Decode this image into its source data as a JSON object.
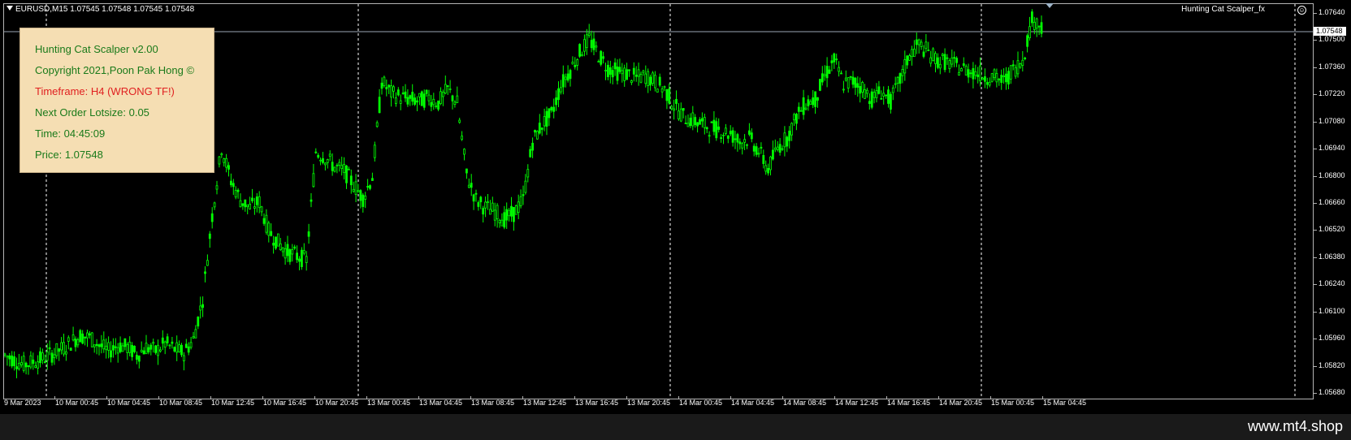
{
  "chart": {
    "symbol_title": "EURUSD,M15  1.07545 1.07548 1.07545 1.07548",
    "expert_name": "Hunting Cat Scalper_fx",
    "current_price_label": "1.07548",
    "price_axis": [
      "1.07640",
      "1.07500",
      "1.07360",
      "1.07220",
      "1.07080",
      "1.06940",
      "1.06800",
      "1.06660",
      "1.06520",
      "1.06380",
      "1.06240",
      "1.06100",
      "1.05960",
      "1.05820",
      "1.05680"
    ],
    "time_axis": [
      "9 Mar 2023",
      "10 Mar 00:45",
      "10 Mar 04:45",
      "10 Mar 08:45",
      "10 Mar 12:45",
      "10 Mar 16:45",
      "10 Mar 20:45",
      "13 Mar 00:45",
      "13 Mar 04:45",
      "13 Mar 08:45",
      "13 Mar 12:45",
      "13 Mar 16:45",
      "13 Mar 20:45",
      "14 Mar 00:45",
      "14 Mar 04:45",
      "14 Mar 08:45",
      "14 Mar 12:45",
      "14 Mar 16:45",
      "14 Mar 20:45",
      "15 Mar 00:45",
      "15 Mar 04:45"
    ],
    "candle_color": "#00ff00",
    "background": "#000000"
  },
  "info_panel": {
    "title": "Hunting Cat Scalper v2.00",
    "copyright": "Copyright 2021,Poon Pak Hong ©",
    "timeframe": "Timeframe: H4 (WRONG TF!)",
    "lotsize": "Next Order Lotsize: 0.05",
    "time": "Time: 04:45:09",
    "price": "Price: 1.07548",
    "text_color": "#1a7a1a",
    "warning_color": "#e02020",
    "background": "#f5deb3"
  },
  "footer": {
    "brand": "www.mt4.shop"
  },
  "chart_data": {
    "type": "line",
    "ylim": [
      1.0568,
      1.0766
    ],
    "anchors": [
      [
        0,
        1.0588
      ],
      [
        2,
        1.0583
      ],
      [
        4,
        1.0586
      ],
      [
        6,
        1.0591
      ],
      [
        8,
        1.0598
      ],
      [
        9,
        1.0597
      ],
      [
        10,
        1.0593
      ],
      [
        11,
        1.059
      ],
      [
        12,
        1.0593
      ],
      [
        13,
        1.0592
      ],
      [
        14,
        1.0588
      ],
      [
        15,
        1.0592
      ],
      [
        16,
        1.059
      ],
      [
        17,
        1.0594
      ],
      [
        18,
        1.0591
      ],
      [
        19,
        1.0589
      ],
      [
        20,
        1.0596
      ],
      [
        21,
        1.0617
      ],
      [
        22,
        1.066
      ],
      [
        23,
        1.0695
      ],
      [
        24,
        1.0678
      ],
      [
        25,
        1.0668
      ],
      [
        26,
        1.0664
      ],
      [
        27,
        1.0667
      ],
      [
        28,
        1.0652
      ],
      [
        29,
        1.0646
      ],
      [
        30,
        1.0641
      ],
      [
        31,
        1.0639
      ],
      [
        32,
        1.0637
      ],
      [
        33,
        1.0693
      ],
      [
        34,
        1.069
      ],
      [
        35,
        1.0685
      ],
      [
        36,
        1.0683
      ],
      [
        37,
        1.0676
      ],
      [
        38,
        1.0669
      ],
      [
        39,
        1.068
      ],
      [
        40,
        1.0729
      ],
      [
        41,
        1.0723
      ],
      [
        42,
        1.0721
      ],
      [
        43,
        1.072
      ],
      [
        44,
        1.0719
      ],
      [
        45,
        1.0721
      ],
      [
        46,
        1.0718
      ],
      [
        47,
        1.0725
      ],
      [
        48,
        1.0718
      ],
      [
        49,
        1.0681
      ],
      [
        50,
        1.0668
      ],
      [
        51,
        1.0664
      ],
      [
        52,
        1.0662
      ],
      [
        53,
        1.0658
      ],
      [
        54,
        1.0661
      ],
      [
        55,
        1.0668
      ],
      [
        56,
        1.0698
      ],
      [
        57,
        1.0707
      ],
      [
        58,
        1.0712
      ],
      [
        59,
        1.0727
      ],
      [
        60,
        1.0735
      ],
      [
        61,
        1.0744
      ],
      [
        62,
        1.0751
      ],
      [
        63,
        1.0743
      ],
      [
        64,
        1.0736
      ],
      [
        65,
        1.0734
      ],
      [
        66,
        1.0733
      ],
      [
        67,
        1.0731
      ],
      [
        68,
        1.0732
      ],
      [
        69,
        1.0729
      ],
      [
        70,
        1.0725
      ],
      [
        71,
        1.0717
      ],
      [
        72,
        1.0711
      ],
      [
        73,
        1.0709
      ],
      [
        74,
        1.0707
      ],
      [
        75,
        1.0705
      ],
      [
        76,
        1.0704
      ],
      [
        77,
        1.0702
      ],
      [
        78,
        1.0698
      ],
      [
        79,
        1.07
      ],
      [
        80,
        1.0693
      ],
      [
        81,
        1.0684
      ],
      [
        82,
        1.0695
      ],
      [
        83,
        1.07
      ],
      [
        84,
        1.0711
      ],
      [
        85,
        1.0718
      ],
      [
        86,
        1.072
      ],
      [
        87,
        1.0732
      ],
      [
        88,
        1.074
      ],
      [
        89,
        1.0728
      ],
      [
        90,
        1.0729
      ],
      [
        91,
        1.0726
      ],
      [
        92,
        1.072
      ],
      [
        93,
        1.0724
      ],
      [
        94,
        1.0719
      ],
      [
        95,
        1.073
      ],
      [
        96,
        1.0743
      ],
      [
        97,
        1.0748
      ],
      [
        98,
        1.0744
      ],
      [
        99,
        1.074
      ],
      [
        100,
        1.0739
      ],
      [
        101,
        1.0737
      ],
      [
        102,
        1.0735
      ],
      [
        103,
        1.0734
      ],
      [
        104,
        1.0732
      ],
      [
        105,
        1.0731
      ],
      [
        106,
        1.0729
      ],
      [
        107,
        1.0735
      ],
      [
        108,
        1.074
      ],
      [
        109,
        1.0761
      ],
      [
        110,
        1.0758
      ]
    ]
  }
}
